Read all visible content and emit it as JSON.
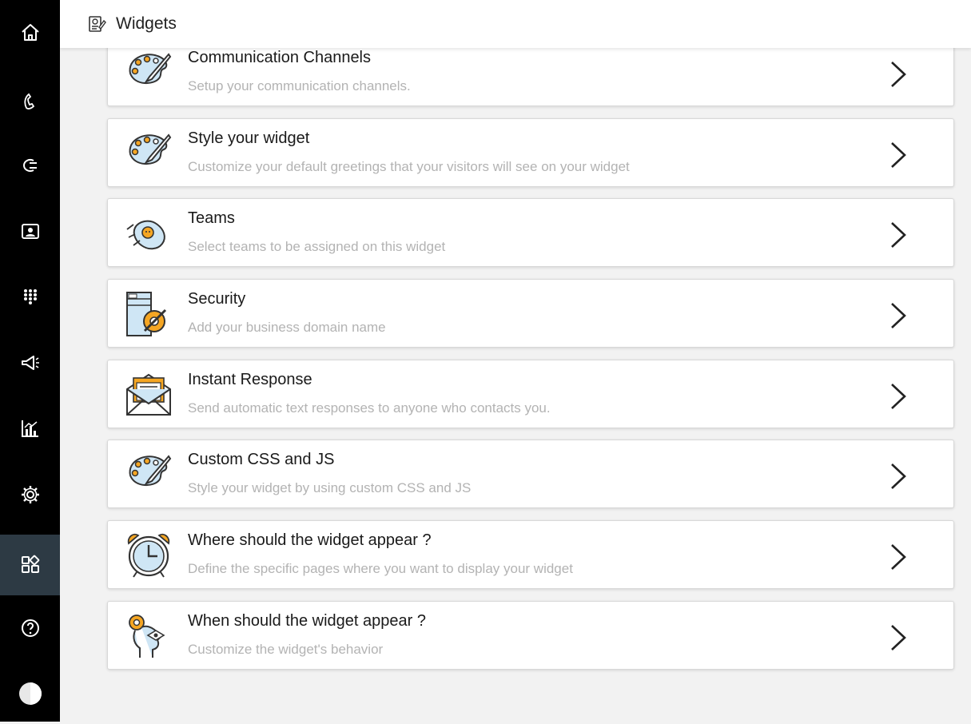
{
  "header": {
    "title": "Widgets",
    "icon": "widget-doc-icon"
  },
  "sidebar": {
    "items": [
      {
        "name": "home",
        "icon": "home-icon"
      },
      {
        "name": "calls",
        "icon": "phone-icon"
      },
      {
        "name": "call-forward",
        "icon": "call-forward-icon"
      },
      {
        "name": "contacts",
        "icon": "contact-card-icon"
      },
      {
        "name": "dialpad",
        "icon": "dialpad-icon"
      },
      {
        "name": "campaigns",
        "icon": "megaphone-icon"
      },
      {
        "name": "reports",
        "icon": "analytics-icon"
      },
      {
        "name": "settings",
        "icon": "gear-icon"
      },
      {
        "name": "widgets",
        "icon": "widgets-grid-icon",
        "active": true
      },
      {
        "name": "help",
        "icon": "help-icon"
      },
      {
        "name": "profile",
        "icon": "avatar-icon"
      }
    ]
  },
  "cards": [
    {
      "title": "Communication Channels",
      "description": "Setup your communication channels.",
      "icon": "palette-icon"
    },
    {
      "title": "Style your widget",
      "description": "Customize your default greetings that your visitors will see on your widget",
      "icon": "palette-icon"
    },
    {
      "title": "Teams",
      "description": "Select teams to be assigned on this widget",
      "icon": "hand-heart-icon"
    },
    {
      "title": "Security",
      "description": "Add your business domain name",
      "icon": "security-gear-icon"
    },
    {
      "title": "Instant Response",
      "description": "Send automatic text responses to anyone who contacts you.",
      "icon": "envelope-icon"
    },
    {
      "title": "Custom CSS and JS",
      "description": "Style your widget by using custom CSS and JS",
      "icon": "palette-icon"
    },
    {
      "title": "Where should the widget appear ?",
      "description": "Define the specific pages where you want to display your widget",
      "icon": "alarm-clock-icon"
    },
    {
      "title": "When should the widget appear ?",
      "description": "Customize the widget's behavior",
      "icon": "head-gear-icon"
    }
  ],
  "colors": {
    "sidebar": "#000000",
    "active": "#2d3a44",
    "accent": "#f5a623",
    "icon_blue": "#cfe6f5"
  }
}
